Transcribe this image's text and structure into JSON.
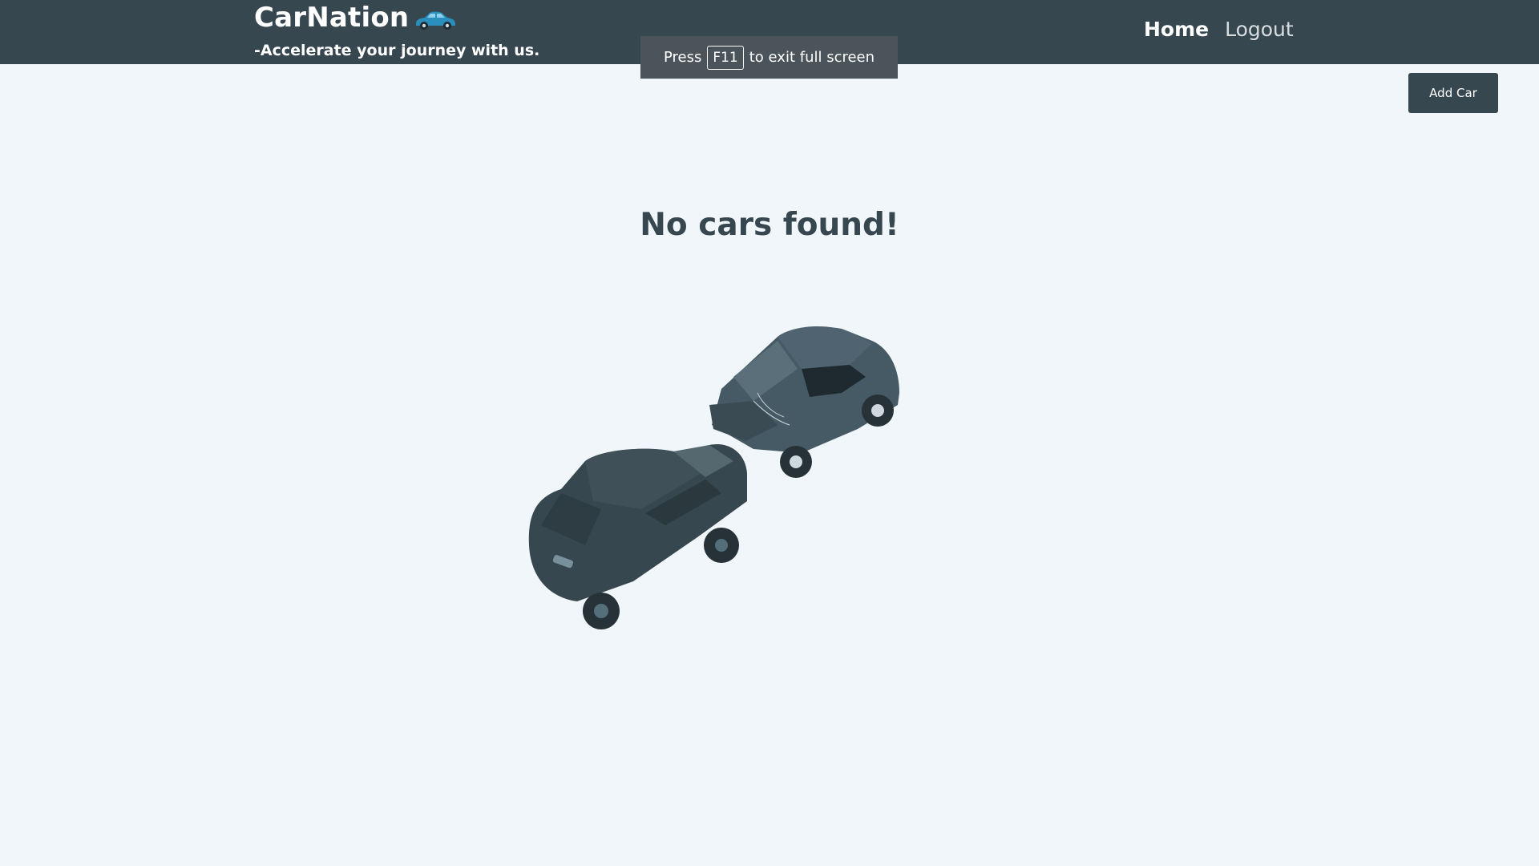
{
  "header": {
    "brand": "CarNation",
    "brand_icon": "car-icon",
    "tagline": "-Accelerate your journey with us.",
    "nav": [
      {
        "label": "Home",
        "active": true
      },
      {
        "label": "Logout",
        "active": false
      }
    ]
  },
  "fullscreen_toast": {
    "before": "Press",
    "key": "F11",
    "after": "to exit full screen"
  },
  "toolbar": {
    "add_car_label": "Add Car"
  },
  "main": {
    "empty_message": "No cars found!",
    "illustration": "car-crash-illustration"
  },
  "colors": {
    "navbar": "#37474f",
    "background": "#f0f6f9",
    "accent_car": "#2b8fbd"
  }
}
